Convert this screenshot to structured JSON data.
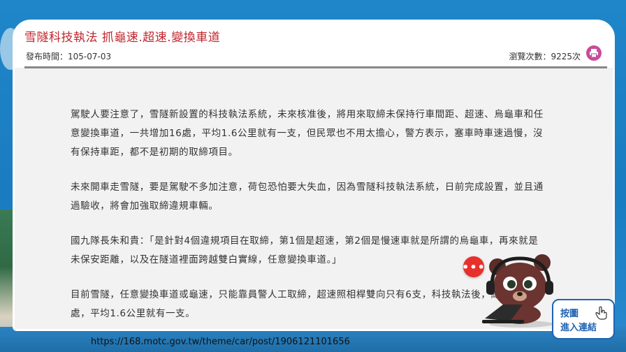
{
  "article": {
    "title": "雪隧科技執法 抓龜速.超速.變換車道",
    "publish_label": "發布時間：",
    "publish_date": "105-07-03",
    "views_label": "瀏覽次數：",
    "views_count": "9225次",
    "paragraphs": [
      "駕駛人要注意了，雪隧新設置的科技執法系統，未來核准後，將用來取締未保持行車間距、超速、烏龜車和任意變換車道，一共增加16處，平均1.6公里就有一支，但民眾也不用太擔心，警方表示，塞車時車速過慢，沒有保持車距，都不是初期的取締項目。",
      "未來開車走雪隧，要是駕駛不多加注意，荷包恐怕要大失血，因為雪隧科技執法系統，日前完成設置，並且通過驗收，將會加強取締違規車輛。",
      "國九隊長朱和貴：「是針對4個違規項目在取締，第1個是超速，第2個是慢速車就是所謂的烏龜車，再來就是未保安距離，以及在隧道裡面跨越雙白實線，任意變換車道。」",
      "目前雪隧，任意變換車道或龜速，只能靠員警人工取締，超速照相桿雙向只有6支，科技執法後，總共多了16處，平均1.6公里就有一支。"
    ]
  },
  "widget": {
    "chat_glyph": "•••",
    "link_line1": "按圖",
    "link_line2": "進入連結"
  },
  "footer": {
    "url": "https://168.motc.gov.tw/theme/car/post/1906121101656"
  },
  "icons": {
    "print": "printer-icon",
    "chat": "chat-icon",
    "hand": "hand-pointer-icon"
  },
  "colors": {
    "title": "#c0262e",
    "print_button": "#c84b9a",
    "chat_bubble": "#e8302b",
    "link_border": "#1d63b3"
  }
}
